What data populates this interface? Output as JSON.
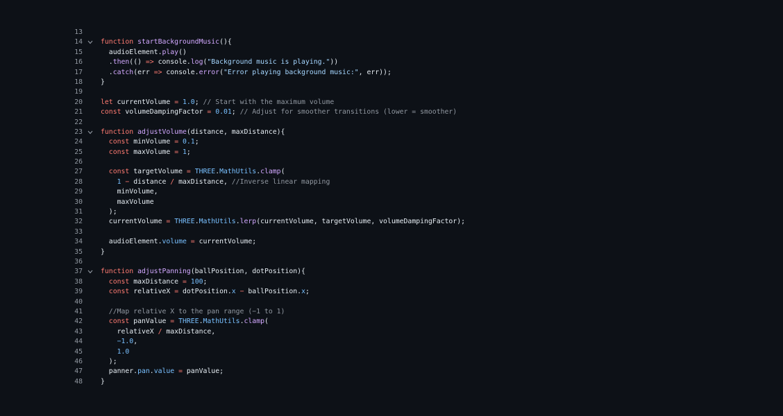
{
  "editor": {
    "lines": [
      {
        "n": "13",
        "fold": false,
        "indent": "",
        "tokens": []
      },
      {
        "n": "14",
        "fold": true,
        "indent": "",
        "tokens": [
          {
            "t": "function",
            "c": "k"
          },
          {
            "t": " ",
            "c": "p"
          },
          {
            "t": "startBackgroundMusic",
            "c": "f"
          },
          {
            "t": "(){",
            "c": "p"
          }
        ]
      },
      {
        "n": "15",
        "fold": false,
        "indent": "  ",
        "tokens": [
          {
            "t": "audioElement.",
            "c": "p"
          },
          {
            "t": "play",
            "c": "f"
          },
          {
            "t": "()",
            "c": "p"
          }
        ]
      },
      {
        "n": "16",
        "fold": false,
        "indent": "  ",
        "tokens": [
          {
            "t": ".",
            "c": "p"
          },
          {
            "t": "then",
            "c": "f"
          },
          {
            "t": "(() ",
            "c": "p"
          },
          {
            "t": "=>",
            "c": "k"
          },
          {
            "t": " console.",
            "c": "p"
          },
          {
            "t": "log",
            "c": "f"
          },
          {
            "t": "(",
            "c": "p"
          },
          {
            "t": "\"Background music is playing.\"",
            "c": "s"
          },
          {
            "t": "))",
            "c": "p"
          }
        ]
      },
      {
        "n": "17",
        "fold": false,
        "indent": "  ",
        "tokens": [
          {
            "t": ".",
            "c": "p"
          },
          {
            "t": "catch",
            "c": "f"
          },
          {
            "t": "(err ",
            "c": "p"
          },
          {
            "t": "=>",
            "c": "k"
          },
          {
            "t": " console.",
            "c": "p"
          },
          {
            "t": "error",
            "c": "f"
          },
          {
            "t": "(",
            "c": "p"
          },
          {
            "t": "\"Error playing background music:\"",
            "c": "s"
          },
          {
            "t": ", err));",
            "c": "p"
          }
        ]
      },
      {
        "n": "18",
        "fold": false,
        "indent": "",
        "tokens": [
          {
            "t": "}",
            "c": "p"
          }
        ]
      },
      {
        "n": "19",
        "fold": false,
        "indent": "",
        "tokens": []
      },
      {
        "n": "20",
        "fold": false,
        "indent": "",
        "tokens": [
          {
            "t": "let",
            "c": "k"
          },
          {
            "t": " currentVolume ",
            "c": "p"
          },
          {
            "t": "=",
            "c": "k"
          },
          {
            "t": " ",
            "c": "p"
          },
          {
            "t": "1.0",
            "c": "n"
          },
          {
            "t": "; ",
            "c": "p"
          },
          {
            "t": "// Start with the maximum volume",
            "c": "c"
          }
        ]
      },
      {
        "n": "21",
        "fold": false,
        "indent": "",
        "tokens": [
          {
            "t": "const",
            "c": "k"
          },
          {
            "t": " volumeDampingFactor ",
            "c": "p"
          },
          {
            "t": "=",
            "c": "k"
          },
          {
            "t": " ",
            "c": "p"
          },
          {
            "t": "0.01",
            "c": "n"
          },
          {
            "t": "; ",
            "c": "p"
          },
          {
            "t": "// Adjust for smoother transitions (lower = smoother)",
            "c": "c"
          }
        ]
      },
      {
        "n": "22",
        "fold": false,
        "indent": "",
        "tokens": []
      },
      {
        "n": "23",
        "fold": true,
        "indent": "",
        "tokens": [
          {
            "t": "function",
            "c": "k"
          },
          {
            "t": " ",
            "c": "p"
          },
          {
            "t": "adjustVolume",
            "c": "f"
          },
          {
            "t": "(distance, maxDistance){",
            "c": "p"
          }
        ]
      },
      {
        "n": "24",
        "fold": false,
        "indent": "  ",
        "tokens": [
          {
            "t": "const",
            "c": "k"
          },
          {
            "t": " minVolume ",
            "c": "p"
          },
          {
            "t": "=",
            "c": "k"
          },
          {
            "t": " ",
            "c": "p"
          },
          {
            "t": "0.1",
            "c": "n"
          },
          {
            "t": ";",
            "c": "p"
          }
        ]
      },
      {
        "n": "25",
        "fold": false,
        "indent": "  ",
        "tokens": [
          {
            "t": "const",
            "c": "k"
          },
          {
            "t": " maxVolume ",
            "c": "p"
          },
          {
            "t": "=",
            "c": "k"
          },
          {
            "t": " ",
            "c": "p"
          },
          {
            "t": "1",
            "c": "n"
          },
          {
            "t": ";",
            "c": "p"
          }
        ]
      },
      {
        "n": "26",
        "fold": false,
        "indent": "",
        "tokens": []
      },
      {
        "n": "27",
        "fold": false,
        "indent": "  ",
        "tokens": [
          {
            "t": "const",
            "c": "k"
          },
          {
            "t": " targetVolume ",
            "c": "p"
          },
          {
            "t": "=",
            "c": "k"
          },
          {
            "t": " ",
            "c": "p"
          },
          {
            "t": "THREE",
            "c": "n"
          },
          {
            "t": ".",
            "c": "p"
          },
          {
            "t": "MathUtils",
            "c": "n"
          },
          {
            "t": ".",
            "c": "p"
          },
          {
            "t": "clamp",
            "c": "f"
          },
          {
            "t": "(",
            "c": "p"
          }
        ]
      },
      {
        "n": "28",
        "fold": false,
        "indent": "    ",
        "tokens": [
          {
            "t": "1",
            "c": "n"
          },
          {
            "t": " ",
            "c": "p"
          },
          {
            "t": "−",
            "c": "k"
          },
          {
            "t": " distance ",
            "c": "p"
          },
          {
            "t": "/",
            "c": "k"
          },
          {
            "t": " maxDistance, ",
            "c": "p"
          },
          {
            "t": "//Inverse linear mapping",
            "c": "c"
          }
        ]
      },
      {
        "n": "29",
        "fold": false,
        "indent": "    ",
        "tokens": [
          {
            "t": "minVolume,",
            "c": "p"
          }
        ]
      },
      {
        "n": "30",
        "fold": false,
        "indent": "    ",
        "tokens": [
          {
            "t": "maxVolume",
            "c": "p"
          }
        ]
      },
      {
        "n": "31",
        "fold": false,
        "indent": "  ",
        "tokens": [
          {
            "t": ");",
            "c": "p"
          }
        ]
      },
      {
        "n": "32",
        "fold": false,
        "indent": "  ",
        "tokens": [
          {
            "t": "currentVolume ",
            "c": "p"
          },
          {
            "t": "=",
            "c": "k"
          },
          {
            "t": " ",
            "c": "p"
          },
          {
            "t": "THREE",
            "c": "n"
          },
          {
            "t": ".",
            "c": "p"
          },
          {
            "t": "MathUtils",
            "c": "n"
          },
          {
            "t": ".",
            "c": "p"
          },
          {
            "t": "lerp",
            "c": "f"
          },
          {
            "t": "(currentVolume, targetVolume, volumeDampingFactor);",
            "c": "p"
          }
        ]
      },
      {
        "n": "33",
        "fold": false,
        "indent": "",
        "tokens": []
      },
      {
        "n": "34",
        "fold": false,
        "indent": "  ",
        "tokens": [
          {
            "t": "audioElement.",
            "c": "p"
          },
          {
            "t": "volume",
            "c": "n"
          },
          {
            "t": " ",
            "c": "p"
          },
          {
            "t": "=",
            "c": "k"
          },
          {
            "t": " currentVolume;",
            "c": "p"
          }
        ]
      },
      {
        "n": "35",
        "fold": false,
        "indent": "",
        "tokens": [
          {
            "t": "}",
            "c": "p"
          }
        ]
      },
      {
        "n": "36",
        "fold": false,
        "indent": "",
        "tokens": []
      },
      {
        "n": "37",
        "fold": true,
        "indent": "",
        "tokens": [
          {
            "t": "function",
            "c": "k"
          },
          {
            "t": " ",
            "c": "p"
          },
          {
            "t": "adjustPanning",
            "c": "f"
          },
          {
            "t": "(ballPosition, dotPosition){",
            "c": "p"
          }
        ]
      },
      {
        "n": "38",
        "fold": false,
        "indent": "  ",
        "tokens": [
          {
            "t": "const",
            "c": "k"
          },
          {
            "t": " maxDistance ",
            "c": "p"
          },
          {
            "t": "=",
            "c": "k"
          },
          {
            "t": " ",
            "c": "p"
          },
          {
            "t": "100",
            "c": "n"
          },
          {
            "t": ";",
            "c": "p"
          }
        ]
      },
      {
        "n": "39",
        "fold": false,
        "indent": "  ",
        "tokens": [
          {
            "t": "const",
            "c": "k"
          },
          {
            "t": " relativeX ",
            "c": "p"
          },
          {
            "t": "=",
            "c": "k"
          },
          {
            "t": " dotPosition.",
            "c": "p"
          },
          {
            "t": "x",
            "c": "n"
          },
          {
            "t": " ",
            "c": "p"
          },
          {
            "t": "−",
            "c": "k"
          },
          {
            "t": " ballPosition.",
            "c": "p"
          },
          {
            "t": "x",
            "c": "n"
          },
          {
            "t": ";",
            "c": "p"
          }
        ]
      },
      {
        "n": "40",
        "fold": false,
        "indent": "",
        "tokens": []
      },
      {
        "n": "41",
        "fold": false,
        "indent": "  ",
        "tokens": [
          {
            "t": "//Map relative X to the pan range (−1 to 1)",
            "c": "c"
          }
        ]
      },
      {
        "n": "42",
        "fold": false,
        "indent": "  ",
        "tokens": [
          {
            "t": "const",
            "c": "k"
          },
          {
            "t": " panValue ",
            "c": "p"
          },
          {
            "t": "=",
            "c": "k"
          },
          {
            "t": " ",
            "c": "p"
          },
          {
            "t": "THREE",
            "c": "n"
          },
          {
            "t": ".",
            "c": "p"
          },
          {
            "t": "MathUtils",
            "c": "n"
          },
          {
            "t": ".",
            "c": "p"
          },
          {
            "t": "clamp",
            "c": "f"
          },
          {
            "t": "(",
            "c": "p"
          }
        ]
      },
      {
        "n": "43",
        "fold": false,
        "indent": "    ",
        "tokens": [
          {
            "t": "relativeX ",
            "c": "p"
          },
          {
            "t": "/",
            "c": "k"
          },
          {
            "t": " maxDistance,",
            "c": "p"
          }
        ]
      },
      {
        "n": "44",
        "fold": false,
        "indent": "    ",
        "tokens": [
          {
            "t": "−1.0",
            "c": "n"
          },
          {
            "t": ",",
            "c": "p"
          }
        ]
      },
      {
        "n": "45",
        "fold": false,
        "indent": "    ",
        "tokens": [
          {
            "t": "1.0",
            "c": "n"
          }
        ]
      },
      {
        "n": "46",
        "fold": false,
        "indent": "  ",
        "tokens": [
          {
            "t": ");",
            "c": "p"
          }
        ]
      },
      {
        "n": "47",
        "fold": false,
        "indent": "  ",
        "tokens": [
          {
            "t": "panner.",
            "c": "p"
          },
          {
            "t": "pan",
            "c": "n"
          },
          {
            "t": ".",
            "c": "p"
          },
          {
            "t": "value",
            "c": "n"
          },
          {
            "t": " ",
            "c": "p"
          },
          {
            "t": "=",
            "c": "k"
          },
          {
            "t": " panValue;",
            "c": "p"
          }
        ]
      },
      {
        "n": "48",
        "fold": false,
        "indent": "",
        "tokens": [
          {
            "t": "}",
            "c": "p"
          }
        ]
      }
    ],
    "fold_icon": "chevron-down-icon"
  },
  "colors": {
    "background": "#0d1117",
    "line_number": "#9198a1",
    "keyword": "#ff7b72",
    "function": "#d2a8ff",
    "constant": "#79c0ff",
    "string": "#a5d6ff",
    "comment": "#9198a1",
    "plain": "#e6edf3"
  }
}
